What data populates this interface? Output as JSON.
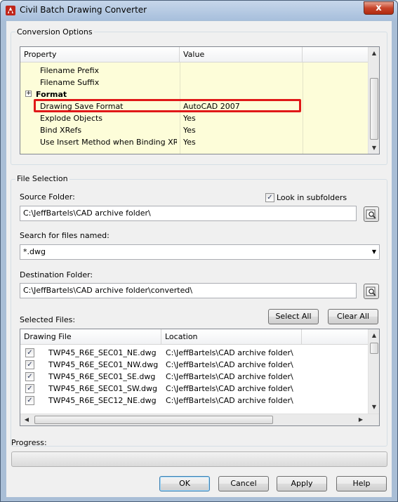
{
  "window": {
    "title": "Civil Batch Drawing Converter",
    "close_glyph": "x"
  },
  "conversion_options": {
    "group_title": "Conversion Options",
    "columns": [
      "Property",
      "Value"
    ],
    "rows": [
      {
        "property": "Filename Prefix",
        "value": ""
      },
      {
        "property": "Filename Suffix",
        "value": ""
      },
      {
        "property": "Format",
        "value": "",
        "category": true,
        "expander": "+"
      },
      {
        "property": "Drawing Save Format",
        "value": "AutoCAD 2007"
      },
      {
        "property": "Explode Objects",
        "value": "Yes"
      },
      {
        "property": "Bind XRefs",
        "value": "Yes"
      },
      {
        "property": "Use Insert Method when Binding XRefs",
        "value": "Yes"
      }
    ]
  },
  "file_selection": {
    "group_title": "File Selection",
    "source_folder_label": "Source Folder:",
    "source_folder_value": "C:\\JeffBartels\\CAD archive folder\\",
    "look_in_subfolders_label": "Look in subfolders",
    "look_in_subfolders_checked": true,
    "search_label": "Search for files named:",
    "search_value": "*.dwg",
    "destination_folder_label": "Destination Folder:",
    "destination_folder_value": "C:\\JeffBartels\\CAD archive folder\\converted\\",
    "selected_files_label": "Selected Files:",
    "select_all_label": "Select All",
    "clear_all_label": "Clear All",
    "columns": [
      "Drawing File",
      "Location"
    ],
    "files": [
      {
        "name": "TWP45_R6E_SEC01_NE.dwg",
        "location": "C:\\JeffBartels\\CAD archive folder\\",
        "checked": true
      },
      {
        "name": "TWP45_R6E_SEC01_NW.dwg",
        "location": "C:\\JeffBartels\\CAD archive folder\\",
        "checked": true
      },
      {
        "name": "TWP45_R6E_SEC01_SE.dwg",
        "location": "C:\\JeffBartels\\CAD archive folder\\",
        "checked": true
      },
      {
        "name": "TWP45_R6E_SEC01_SW.dwg",
        "location": "C:\\JeffBartels\\CAD archive folder\\",
        "checked": true
      },
      {
        "name": "TWP45_R6E_SEC12_NE.dwg",
        "location": "C:\\JeffBartels\\CAD archive folder\\",
        "checked": true
      }
    ]
  },
  "progress": {
    "label": "Progress:",
    "value": 0
  },
  "buttons": {
    "ok": "OK",
    "cancel": "Cancel",
    "apply": "Apply",
    "help": "Help"
  },
  "colors": {
    "highlight": "#e01818",
    "property_grid_margin": "#fdfdd9",
    "window_frame": "#a9bed6"
  }
}
